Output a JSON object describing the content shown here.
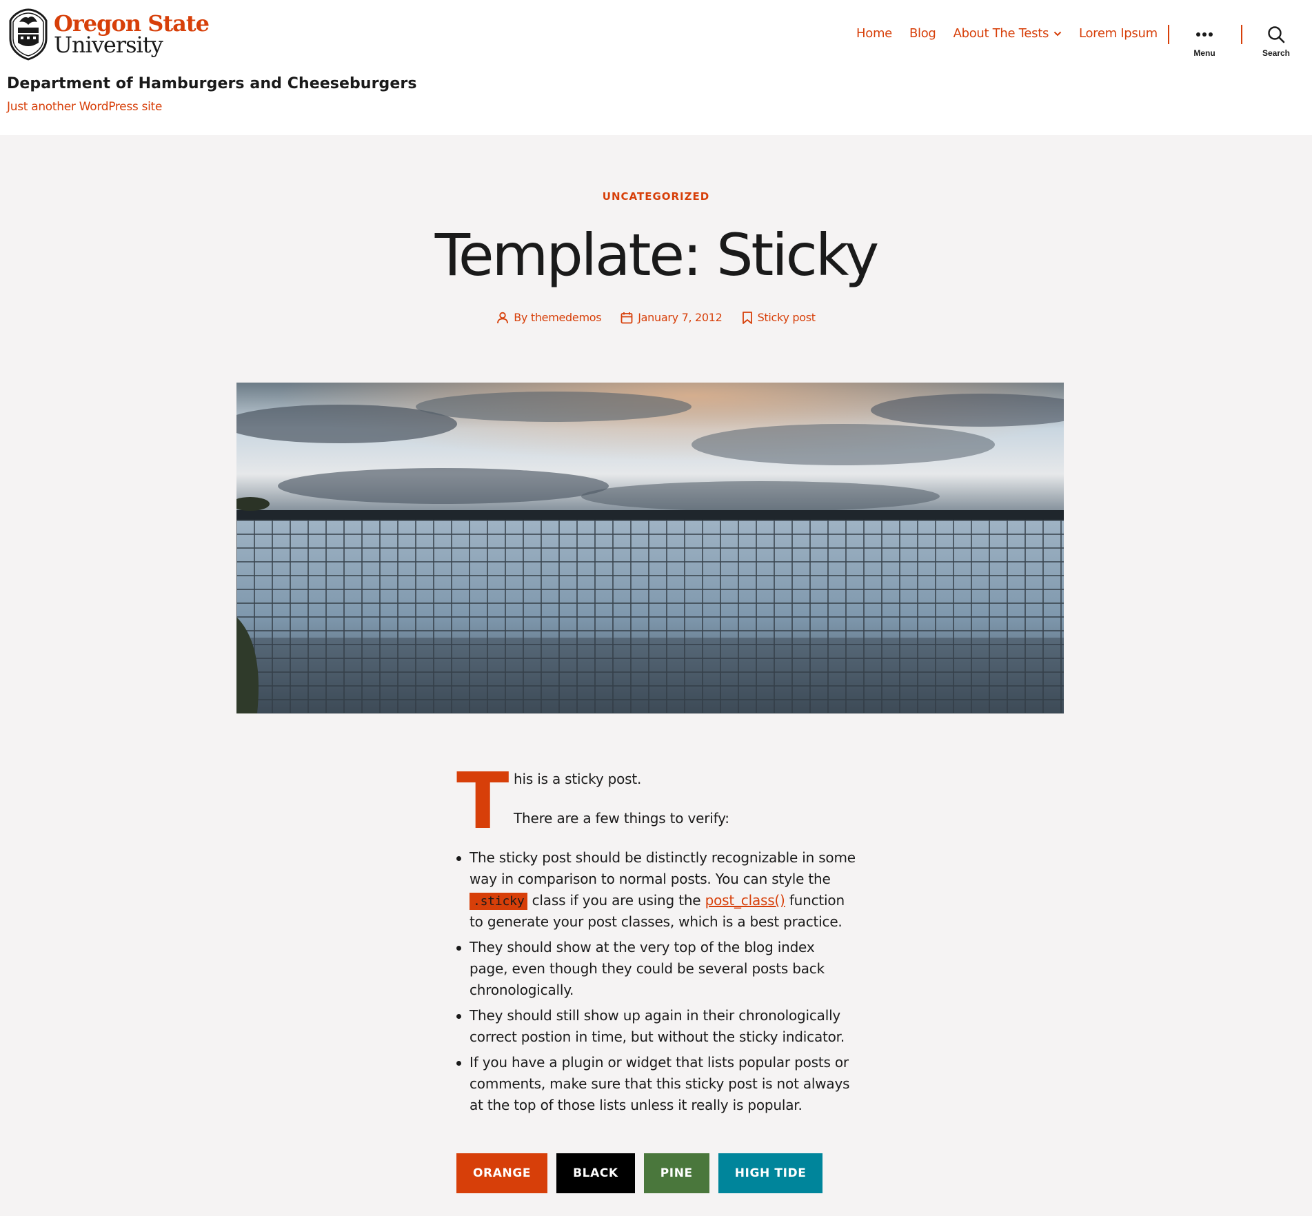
{
  "brand": {
    "line1": "Oregon State",
    "line2": "University",
    "accent": "#d73f09"
  },
  "site": {
    "title": "Department of Hamburgers and Cheeseburgers",
    "description": "Just another WordPress site"
  },
  "nav": {
    "items": [
      {
        "label": "Home"
      },
      {
        "label": "Blog"
      },
      {
        "label": "About The Tests",
        "has_submenu": true
      },
      {
        "label": "Lorem Ipsum"
      }
    ],
    "menu_label": "Menu",
    "search_label": "Search"
  },
  "post": {
    "category": "UNCATEGORIZED",
    "title": "Template: Sticky",
    "author": "By themedemos",
    "date": "January 7, 2012",
    "sticky_label": "Sticky post",
    "dropcap": "T",
    "intro_rest": "his is a sticky post.",
    "para2": "There are a few things to verify:",
    "bullets": {
      "b1_before": "The sticky post should be distinctly recognizable in some way in comparison to normal posts. You can style the",
      "b1_code": ".sticky",
      "b1_middle": "class if you are using the",
      "b1_link": "post_class()",
      "b1_after": "function to generate your post classes, which is a best practice.",
      "b2": "They should show at the very top of the blog index page, even though they could be several posts back chronologically.",
      "b3": "They should still show up again in their chronologically correct postion in time, but without the sticky indicator.",
      "b4": "If you have a plugin or widget that lists popular posts or comments, make sure that this sticky post is not always at the top of those lists unless it really is popular."
    }
  },
  "buttons": [
    {
      "label": "ORANGE",
      "color": "#d73f09"
    },
    {
      "label": "BLACK",
      "color": "#000000"
    },
    {
      "label": "PINE",
      "color": "#4a773c"
    },
    {
      "label": "HIGH TIDE",
      "color": "#00859b"
    }
  ]
}
